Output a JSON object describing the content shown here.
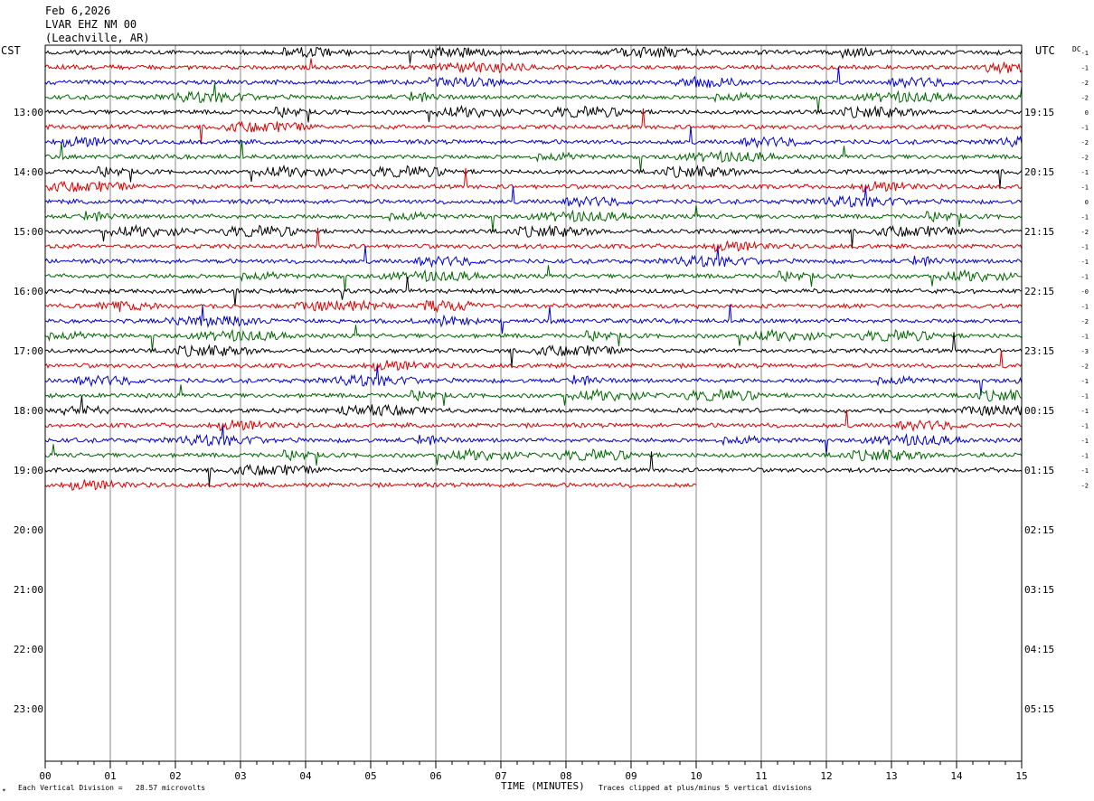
{
  "header": {
    "date": "Feb 6,2026",
    "station": "LVAR EHZ NM 00",
    "location": "(Leachville, AR)"
  },
  "left_tz": "CST",
  "right_tz": "UTC",
  "dc_label": "DC",
  "footer": {
    "scale_note": "Each Vertical Division =   28.57 microvolts",
    "clip_note": "Traces clipped at plus/minus 5 vertical divisions",
    "mark": "✴"
  },
  "colors": {
    "trace_cycle": [
      "#000000",
      "#dd0000",
      "#0000cc",
      "#006600"
    ],
    "grid": "#888888"
  },
  "chart_data": {
    "type": "line",
    "title": "LVAR EHZ NM 00",
    "xlabel": "TIME (MINUTES)",
    "ylabel": "",
    "xlim": [
      0,
      15
    ],
    "x_ticks": [
      "00",
      "01",
      "02",
      "03",
      "04",
      "05",
      "06",
      "07",
      "08",
      "09",
      "10",
      "11",
      "12",
      "13",
      "14",
      "15"
    ],
    "left_hour_labels": [
      "13:00",
      "14:00",
      "15:00",
      "16:00",
      "17:00",
      "18:00",
      "19:00",
      "20:00",
      "21:00",
      "22:00",
      "23:00"
    ],
    "right_hour_labels": [
      "19:15",
      "20:15",
      "21:15",
      "22:15",
      "23:15",
      "00:15",
      "01:15",
      "02:15",
      "03:15",
      "04:15",
      "05:15"
    ],
    "rows_per_hour": 4,
    "start_time_cst": "12:00",
    "total_rows": 52,
    "recorded_rows": 30,
    "last_row_end_minute": 10,
    "dc_offsets": [
      "-1",
      "-1",
      "-2",
      "-2",
      "0",
      "-1",
      "-2",
      "-2",
      "-1",
      "-1",
      "0",
      "-1",
      "-2",
      "-1",
      "-1",
      "-1",
      "-0",
      "-1",
      "-2",
      "-1",
      "-3",
      "-2",
      "-1",
      "-1",
      "-1",
      "-1",
      "-1",
      "-1",
      "-1",
      "-2"
    ],
    "trace_colors": [
      "black",
      "red",
      "blue",
      "green"
    ],
    "scale_microvolts_per_division": 28.57,
    "clip_divisions": 5
  }
}
